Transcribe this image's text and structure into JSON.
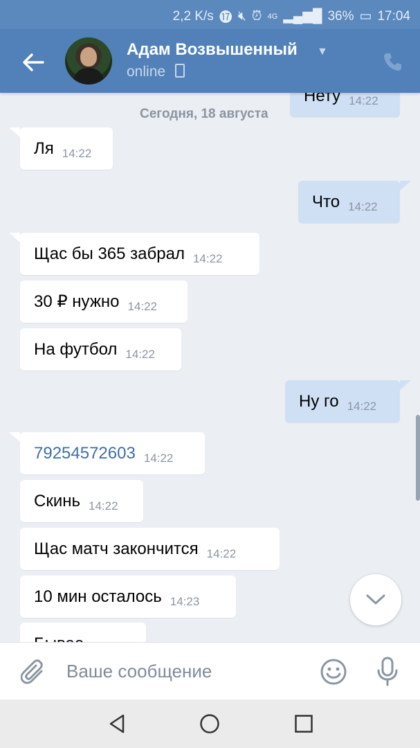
{
  "status": {
    "net_speed": "2,2 K/s",
    "network": "4G",
    "battery": "36%",
    "time": "17:04"
  },
  "header": {
    "contact_name": "Адам Возвышенный",
    "presence": "online"
  },
  "chat": {
    "date_separator": "Сегодня, 18 августа",
    "messages": [
      {
        "dir": "out",
        "text": "Нету",
        "time": "14:22"
      },
      {
        "dir": "in",
        "text": "Ля",
        "time": "14:22"
      },
      {
        "dir": "out",
        "text": "Что",
        "time": "14:22"
      },
      {
        "dir": "in",
        "text": "Щас бы 365 забрал",
        "time": "14:22"
      },
      {
        "dir": "in",
        "text": "30 ₽ нужно",
        "time": "14:22"
      },
      {
        "dir": "in",
        "text": "На футбол",
        "time": "14:22"
      },
      {
        "dir": "out",
        "text": "Ну го",
        "time": "14:22"
      },
      {
        "dir": "in",
        "text": "79254572603",
        "time": "14:22",
        "link": true
      },
      {
        "dir": "in",
        "text": "Скинь",
        "time": "14:22"
      },
      {
        "dir": "in",
        "text": "Щас матч закончится",
        "time": "14:22"
      },
      {
        "dir": "in",
        "text": "10 мин осталось",
        "time": "14:23"
      },
      {
        "dir": "in",
        "text": "Бывае...",
        "time": ""
      }
    ]
  },
  "composer": {
    "placeholder": "Ваше сообщение"
  },
  "icons": {
    "back": "arrow-left-icon",
    "phone": "phone-icon",
    "attach": "paperclip-icon",
    "emoji": "smile-icon",
    "mic": "microphone-icon",
    "scroll_down": "chevron-down-icon",
    "nav_back": "triangle-back-icon",
    "nav_home": "circle-home-icon",
    "nav_recent": "square-recent-icon"
  },
  "colors": {
    "header": "#5181b8",
    "outgoing_bubble": "#cfe0f5",
    "incoming_bubble": "#ffffff",
    "background": "#ebeef2",
    "link": "#3f6ea8"
  }
}
